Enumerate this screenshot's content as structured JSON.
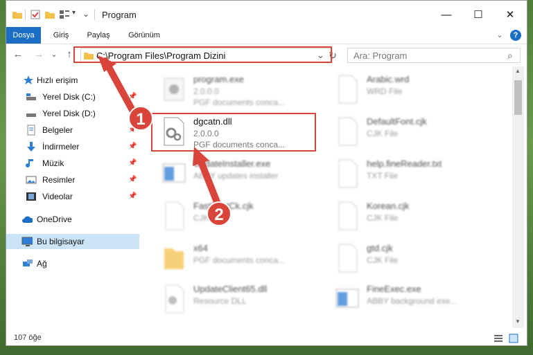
{
  "window": {
    "title": "Program",
    "minimize": "—",
    "maximize": "☐",
    "close": "✕"
  },
  "ribbon": {
    "tabs": [
      "Dosya",
      "Giriş",
      "Paylaş",
      "Görünüm"
    ],
    "active_tab": "Dosya",
    "expand": "⌄",
    "help": "?"
  },
  "nav": {
    "back": "←",
    "forward": "→",
    "recent": "⌄",
    "up": "↑",
    "address": "C:\\Program Files\\Program Dizini",
    "address_dropdown": "⌄",
    "refresh": "↻",
    "search_placeholder": "Ara: Program",
    "search_icon": "⌕"
  },
  "sidebar": {
    "items": [
      {
        "label": "Hızlı erişim"
      },
      {
        "label": "Yerel Disk (C:)"
      },
      {
        "label": "Yerel Disk (D:)"
      },
      {
        "label": "Belgeler"
      },
      {
        "label": "İndirmeler"
      },
      {
        "label": "Müzik"
      },
      {
        "label": "Resimler"
      },
      {
        "label": "Videolar"
      },
      {
        "label": "OneDrive"
      },
      {
        "label": "Bu bilgisayar"
      },
      {
        "label": "Ağ"
      }
    ],
    "pin": "📌"
  },
  "files": {
    "left": [
      {
        "name": "program.exe",
        "l2": "2.0.0.0",
        "l3": "PGF documents conca..."
      },
      {
        "name": "dgcatn.dll",
        "l2": "2.0.0.0",
        "l3": "PGF documents conca..."
      },
      {
        "name": "UpdateInstaller.exe",
        "l2": "ABBY updates installer",
        "l3": ""
      },
      {
        "name": "FastFontCk.cjk",
        "l2": "CJK File",
        "l3": ""
      },
      {
        "name": "x64",
        "l2": "PGF documents conca...",
        "l3": ""
      },
      {
        "name": "UpdateClient65.dll",
        "l2": "Resource DLL",
        "l3": ""
      }
    ],
    "right": [
      {
        "name": "Arabic.wrd",
        "l2": "WRD File"
      },
      {
        "name": "DefaultFont.cjk",
        "l2": "CJK File"
      },
      {
        "name": "help.fineReader.txt",
        "l2": "TXT File"
      },
      {
        "name": "Korean.cjk",
        "l2": "CJK File"
      },
      {
        "name": "gtd.cjk",
        "l2": "CJK File"
      },
      {
        "name": "FineExec.exe",
        "l2": "ABBY background exe..."
      }
    ]
  },
  "annotations": {
    "step1": "1",
    "step2": "2"
  },
  "status": {
    "count": "107 öğe"
  },
  "colors": {
    "accent": "#1a6fc4",
    "marker": "#d9453b",
    "folder": "#f3c04a"
  }
}
